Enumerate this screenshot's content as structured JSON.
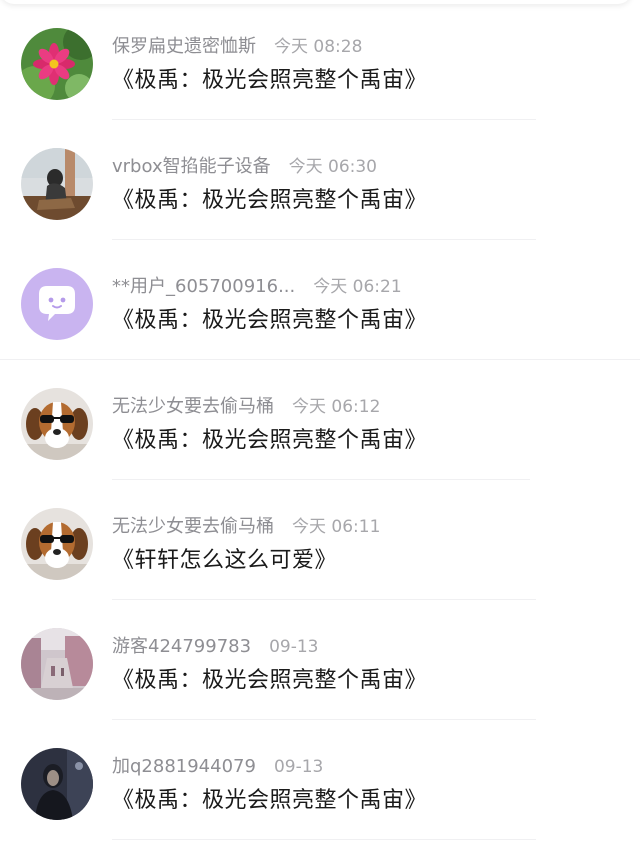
{
  "comments": [
    {
      "name": "保罗扁史遗密恤斯",
      "time": "今天 08:28",
      "text": "《极禹：极光会照亮整个禹宙》",
      "avatar": "flower-photo-avatar"
    },
    {
      "name": "vrbox智掐能子设备",
      "time": "今天 06:30",
      "text": "《极禹：极光会照亮整个禹宙》",
      "avatar": "person-sitting-photo-avatar"
    },
    {
      "name": "**用户_605700916...",
      "time": "今天 06:21",
      "text": "《极禹：极光会照亮整个禹宙》",
      "avatar": "chat-bubble-default-avatar"
    },
    {
      "name": "无法少女要去偷马桶",
      "time": "今天 06:12",
      "text": "《极禹：极光会照亮整个禹宙》",
      "avatar": "beagle-sunglasses-avatar"
    },
    {
      "name": "无法少女要去偷马桶",
      "time": "今天 06:11",
      "text": "《轩轩怎么这么可爱》",
      "avatar": "beagle-sunglasses-avatar"
    },
    {
      "name": "游客424799783",
      "time": "09-13",
      "text": "《极禹：极光会照亮整个禹宙》",
      "avatar": "street-scene-photo-avatar"
    },
    {
      "name": "加q2881944079",
      "time": "09-13",
      "text": "《极禹：极光会照亮整个禹宙》",
      "avatar": "dark-portrait-photo-avatar"
    }
  ]
}
